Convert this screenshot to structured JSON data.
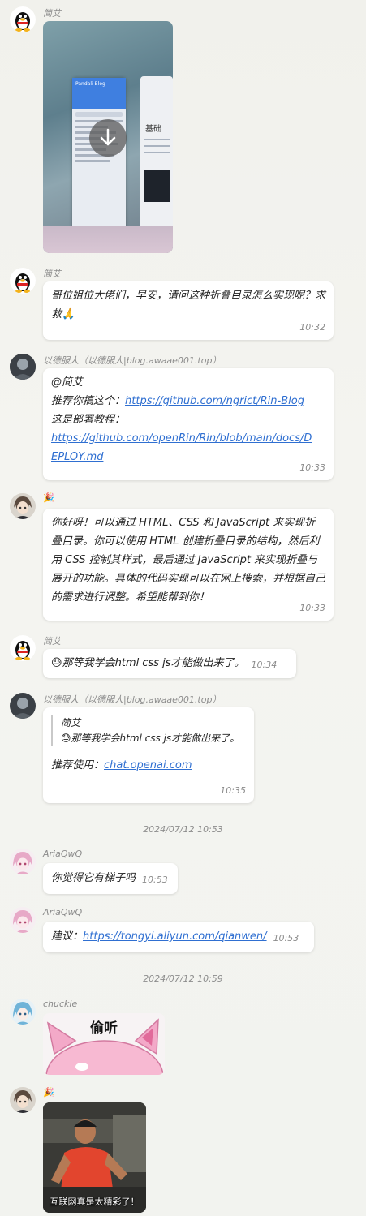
{
  "messages": {
    "m1": {
      "sender": "简艾",
      "avatar_icon": "penguin-avatar-icon",
      "image_title": "Pandali Blog",
      "image_heading": "基础",
      "download_icon": "download-icon"
    },
    "m2": {
      "sender": "简艾",
      "text": "哥位姐位大佬们，早安，请问这种折叠目录怎么实现呢？求救",
      "emoji": "🙏",
      "time": "10:32"
    },
    "m3": {
      "sender": "以德服人（以德服人|blog.awaae001.top）",
      "mention": "@简艾",
      "line1_prefix": "推荐你搞这个：",
      "link1": "https://github.com/ngrict/Rin-Blog",
      "line2": "这是部署教程：",
      "link2a": "https://github.com/openRin/Rin/blob/main/docs/D",
      "link2b": "EPLOY.md",
      "time": "10:33"
    },
    "m4": {
      "sender_emoji": "🎉",
      "text": "你好呀！可以通过 HTML、CSS 和 JavaScript 来实现折叠目录。你可以使用 HTML 创建折叠目录的结构，然后利用 CSS 控制其样式，最后通过 JavaScript 来实现折叠与展开的功能。具体的代码实现可以在网上搜索，并根据自己的需求进行调整。希望能帮到你！",
      "time": "10:33"
    },
    "m5": {
      "sender": "简艾",
      "emoji": "😓",
      "text": "那等我学会html css js才能做出来了。",
      "time": "10:34"
    },
    "m6": {
      "sender": "以德服人（以德服人|blog.awaae001.top）",
      "quote_name": "简艾",
      "quote_emoji": "😓",
      "quote_text": "那等我学会html css js才能做出来了。",
      "prefix": "推荐使用：",
      "link": "chat.openai.com",
      "time": "10:35"
    },
    "date1": "2024/07/12 10:53",
    "m7": {
      "sender": "AriaQwQ",
      "text": "你觉得它有梯子吗",
      "time": "10:53"
    },
    "m8": {
      "sender": "AriaQwQ",
      "prefix": "建议：",
      "link": "https://tongyi.aliyun.com/qianwen/",
      "time": "10:53"
    },
    "date2": "2024/07/12 10:59",
    "m9": {
      "sender": "chuckle",
      "sticker_text": "偷听"
    },
    "m10": {
      "sender_emoji": "🎉",
      "caption": "互联网真是太精彩了！"
    }
  },
  "colors": {
    "link": "#2f6fd1",
    "bubble": "#ffffff",
    "meta": "#8c8c8c"
  }
}
